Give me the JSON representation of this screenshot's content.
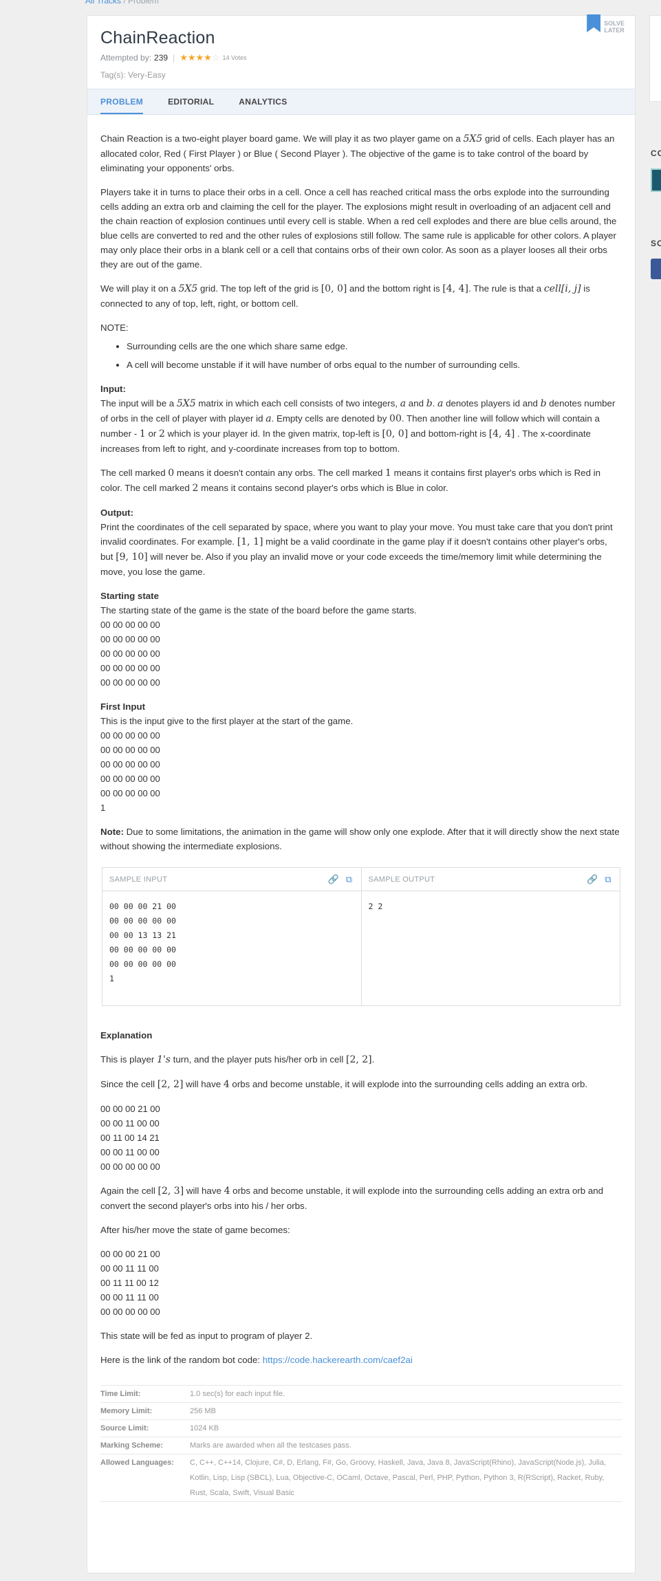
{
  "breadcrumb": {
    "parent": "All Tracks",
    "sep": "/",
    "current": "Problem"
  },
  "problem": {
    "title": "ChainReaction",
    "attempted_label": "Attempted by:",
    "attempted_count": "239",
    "rating_stars": 4,
    "votes": "14 Votes",
    "tags": "Tag(s): Very-Easy",
    "solve_later": "SOLVE LATER"
  },
  "tabs": [
    {
      "label": "PROBLEM",
      "active": true
    },
    {
      "label": "EDITORIAL",
      "active": false
    },
    {
      "label": "ANALYTICS",
      "active": false
    }
  ],
  "statement": {
    "p1a": "Chain Reaction is a two-eight player board game. We will play it as two player game on a ",
    "p1m": "5X5",
    "p1b": " grid of cells. Each player has an allocated color, Red ( First Player ) or Blue ( Second Player ). The objective of the game is to take control of the board by eliminating your opponents' orbs.",
    "p2": "Players take it in turns to place their orbs in a cell. Once a cell has reached critical mass the orbs explode into the surrounding cells adding an extra orb and claiming the cell for the player. The explosions might result in overloading of an adjacent cell and the chain reaction of explosion continues until every cell is stable. When a red cell explodes and there are blue cells around, the blue cells are converted to red and the other rules of explosions still follow. The same rule is applicable for other colors. A player may only place their orbs in a blank cell or a cell that contains orbs of their own color. As soon as a player looses all their orbs they are out of the game.",
    "p3a": "We will play it on a ",
    "p3m1": "5X5",
    "p3b": " grid. The top left of the grid is ",
    "p3m2": "[0, 0]",
    "p3c": " and the bottom right is ",
    "p3m3": "[4, 4]",
    "p3d": ". The rule is that a ",
    "p3m4": "cell[i, j]",
    "p3e": " is connected to any of top, left, right, or bottom cell.",
    "note_label": "NOTE:",
    "note_items": [
      "Surrounding cells are the one which share same edge.",
      "A cell will become unstable if it will have number of orbs equal to the number of surrounding cells."
    ],
    "input_title": "Input:",
    "input_a": "The input will be a ",
    "input_m1": "5X5",
    "input_b": " matrix in which each cell consists of two integers, ",
    "input_m2": "a",
    "input_c": " and ",
    "input_m3": "b",
    "input_d": ". ",
    "input_m4": "a",
    "input_e": " denotes players id and ",
    "input_m5": "b",
    "input_f": " denotes number of orbs in the cell of player with player id ",
    "input_m6": "a",
    "input_g": ". Empty cells are denoted by ",
    "input_m7": "00",
    "input_h": ". Then another line will follow which will contain a number - ",
    "input_m8": "1",
    "input_i": " or ",
    "input_m9": "2",
    "input_j": " which is your player id. In the given matrix, top-left is ",
    "input_m10": "[0, 0]",
    "input_k": " and bottom-right is ",
    "input_m11": "[4, 4]",
    "input_l": " . The x-coordinate increases from left to right, and y-coordinate increases from top to bottom.",
    "cell_a": "The cell marked ",
    "cell_m1": "0",
    "cell_b": " means it doesn't contain any orbs. The cell marked ",
    "cell_m2": "1",
    "cell_c": " means it contains first player's orbs which is Red in color. The cell marked ",
    "cell_m3": "2",
    "cell_d": " means it contains second player's orbs which is Blue in color.",
    "output_title": "Output:",
    "output_a": "Print the coordinates of the cell separated by space, where you want to play your move. You must take care that you don't print invalid coordinates. For example. ",
    "output_m1": "[1, 1]",
    "output_b": " might be a valid coordinate in the game play if it doesn't contains other player's orbs, but ",
    "output_m2": "[9, 10]",
    "output_c": " will never be. Also if you play an invalid move or your code exceeds the time/memory limit while determining the move, you lose the game.",
    "start_title": "Starting state",
    "start_desc": "The starting state of the game is the state of the board before the game starts.",
    "start_grid": "00 00 00 00 00\n00 00 00 00 00\n00 00 00 00 00\n00 00 00 00 00\n00 00 00 00 00",
    "first_title": "First Input",
    "first_desc": "This is the input give to the first player at the start of the game.",
    "first_grid": "00 00 00 00 00\n00 00 00 00 00\n00 00 00 00 00\n00 00 00 00 00\n00 00 00 00 00\n1",
    "note2_label": "Note:",
    "note2_text": " Due to some limitations, the animation in the game will show only one explode. After that it will directly show the next state without showing the intermediate explosions."
  },
  "samples": {
    "input_label": "SAMPLE INPUT",
    "output_label": "SAMPLE OUTPUT",
    "input": "00 00 00 21 00\n00 00 00 00 00\n00 00 13 13 21\n00 00 00 00 00\n00 00 00 00 00\n1",
    "output": "2 2"
  },
  "explanation": {
    "title": "Explanation",
    "e1a": "This is player ",
    "e1m": "1's",
    "e1b": " turn, and the player puts his/her orb in cell ",
    "e1m2": "[2, 2]",
    "e1c": ".",
    "e2a": "Since the cell ",
    "e2m": "[2, 2]",
    "e2b": " will have ",
    "e2m2": "4",
    "e2c": " orbs and become unstable, it will explode into the surrounding cells adding an extra orb.",
    "grid1": "00 00 00 21 00\n00 00 11 00 00\n00 11 00 14 21\n00 00 11 00 00\n00 00 00 00 00",
    "e3a": "Again the cell ",
    "e3m": "[2, 3]",
    "e3b": " will have ",
    "e3m2": "4",
    "e3c": " orbs and become unstable, it will explode into the surrounding cells adding an extra orb and convert the second player's orbs into his / her orbs.",
    "e4": "After his/her move the state of game becomes:",
    "grid2": "00 00 00 21 00\n00 00 11 11 00\n00 11 11 00 12\n00 00 11 11 00\n00 00 00 00 00",
    "e5": "This state will be fed as input to program of player 2.",
    "e6": "Here is the link of the random bot code: ",
    "e6link": "https://code.hackerearth.com/caef2ai"
  },
  "limits": [
    {
      "key": "Time Limit:",
      "value": "1.0 sec(s) for each input file."
    },
    {
      "key": "Memory Limit:",
      "value": "256 MB"
    },
    {
      "key": "Source Limit:",
      "value": "1024 KB"
    },
    {
      "key": "Marking Scheme:",
      "value": "Marks are awarded when all the testcases pass."
    },
    {
      "key": "Allowed Languages:",
      "value": "C, C++, C++14, Clojure, C#, D, Erlang, F#, Go, Groovy, Haskell, Java, Java 8, JavaScript(Rhino), JavaScript(Node.js), Julia, Kotlin, Lisp, Lisp (SBCL), Lua, Objective-C, OCaml, Octave, Pascal, Perl, PHP, Python, Python 3, R(RScript), Racket, Ruby, Rust, Scala, Swift, Visual Basic"
    }
  ],
  "sidebar": {
    "label1": "CO",
    "label2": "SC"
  },
  "colors": {
    "accent": "#4a90d9",
    "star": "#f5a623"
  }
}
